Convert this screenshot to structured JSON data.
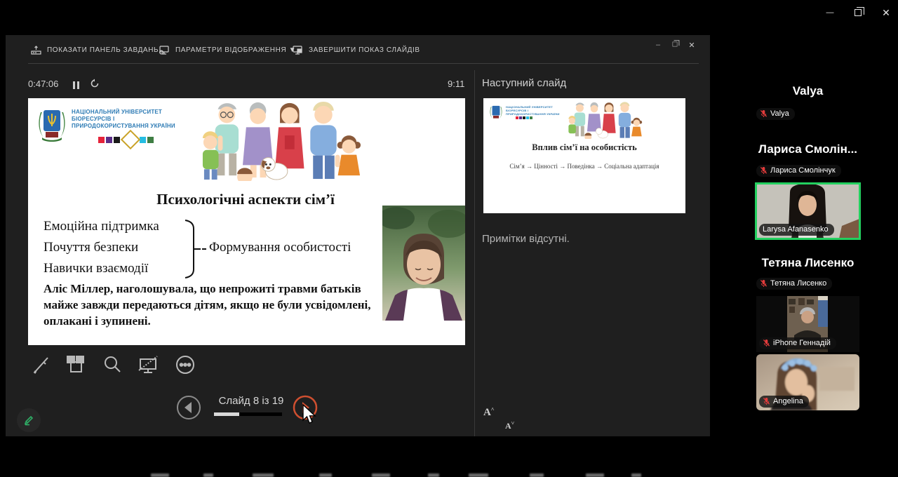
{
  "window": {
    "controls": {
      "minimize_glyph": "—",
      "close_glyph": "✕"
    }
  },
  "presenter": {
    "window_controls": {
      "minimize_glyph": "–",
      "close_glyph": "✕"
    },
    "toolbar": {
      "items": [
        {
          "label": "ПОКАЗАТИ ПАНЕЛЬ ЗАВДАНЬ"
        },
        {
          "label": "ПАРАМЕТРИ ВІДОБРАЖЕННЯ ▼"
        },
        {
          "label": "ЗАВЕРШИТИ ПОКАЗ СЛАЙДІВ"
        }
      ]
    },
    "timer": {
      "elapsed": "0:47:06",
      "clock": "9:11"
    },
    "slide": {
      "university_name": "НАЦІОНАЛЬНИЙ УНІВЕРСИТЕТ БІОРЕСУРСІВ І ПРИРОДОКОРИСТУВАННЯ УКРАЇНИ",
      "title": "Психологічні аспекти сім’ї",
      "bullets": [
        "Емоційна підтримка",
        "Почуття безпеки",
        "Навички взаємодії"
      ],
      "brace_result": "Формування особистості",
      "quote": "Аліс Міллер, наголошувала, що непрожиті травми батьків майже завжди передаються дітям, якщо не були усвідомлені, оплакані і зупинені."
    },
    "next_panel": {
      "header": "Наступний слайд",
      "slide_title": "Вплив сім’ї на особистість",
      "slide_flow": "Сім’я → Цінності → Поведінка → Соціальна адаптація"
    },
    "notes": {
      "empty_text": "Примітки відсутні.",
      "font_larger_glyph": "A",
      "font_smaller_glyph": "A"
    },
    "nav": {
      "position_label": "Слайд 8 із 19",
      "progress_style": "width:36px"
    }
  },
  "participants": {
    "tiles": [
      {
        "type": "name",
        "display": "Valya",
        "nameplate": "Valya"
      },
      {
        "type": "name",
        "display": "Лариса Смолін...",
        "nameplate": "Лариса Смолінчук"
      },
      {
        "type": "video",
        "nameplate": "Larysa Afanasenko"
      },
      {
        "type": "name",
        "display": "Тетяна Лисенко",
        "nameplate": "Тетяна Лисенко"
      },
      {
        "type": "video",
        "nameplate": "iPhone Геннадій"
      },
      {
        "type": "video",
        "nameplate": "Angelina"
      }
    ]
  },
  "colors": {
    "active_speaker_border": "#23d05f",
    "next_button_orange": "#cf4f30",
    "muted_mic_red": "#e23b3b",
    "annotation_green": "#2fae66",
    "university_blue": "#2f7cb5"
  }
}
